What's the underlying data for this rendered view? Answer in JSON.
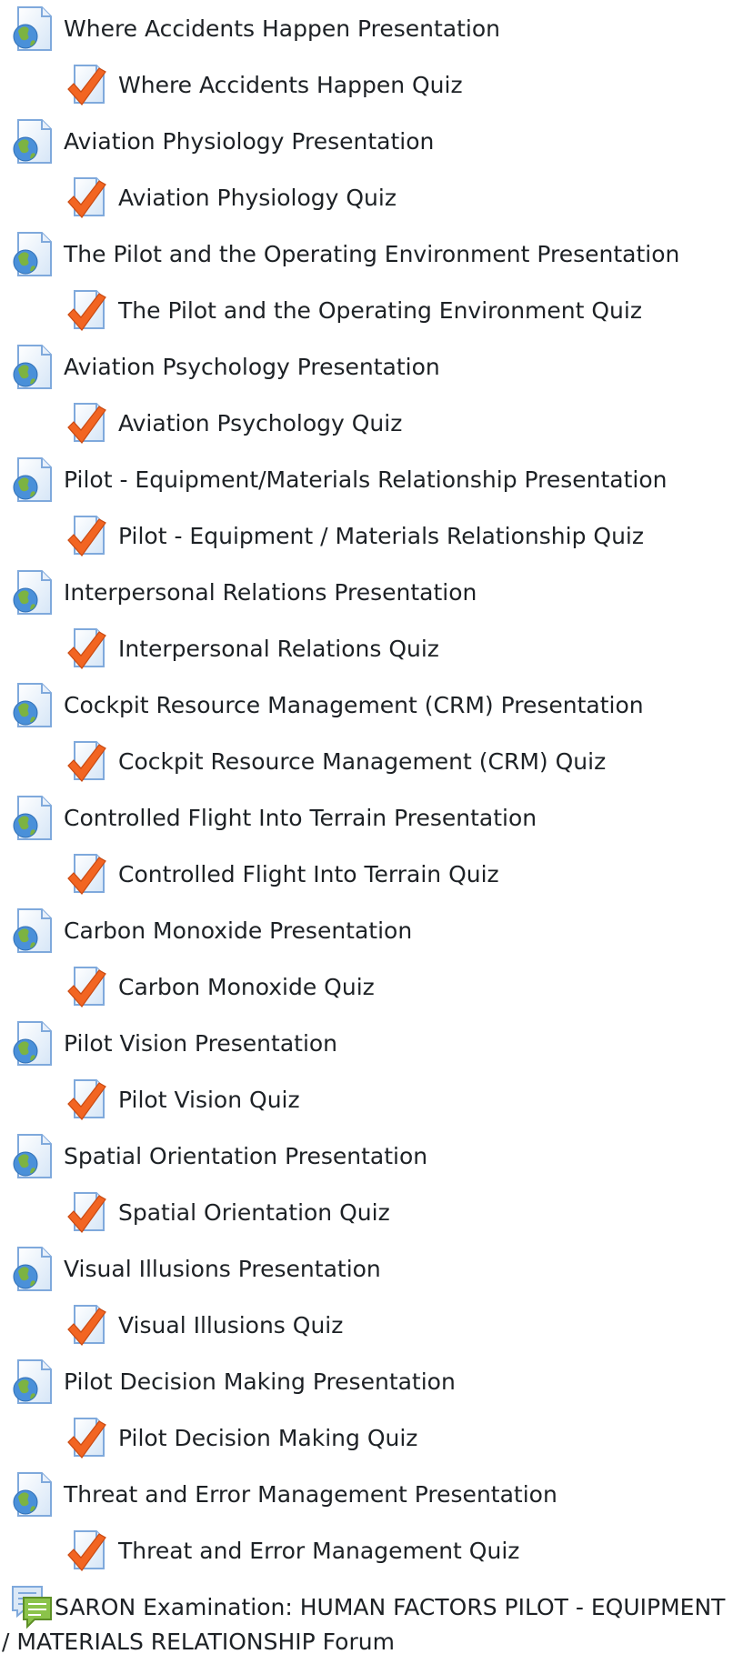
{
  "colors": {
    "page_icon_blue": "#8eb8e6",
    "globe_green": "#7cb342",
    "checkmark_orange": "#f26522",
    "forum_green": "#8bc34a",
    "text": "#1d2125"
  },
  "icons": {
    "presentation": "url-globe-icon",
    "quiz": "quiz-checkmark-icon",
    "forum": "forum-chat-icon"
  },
  "activities": [
    {
      "presentation": "Where Accidents Happen Presentation",
      "quiz": "Where Accidents Happen Quiz"
    },
    {
      "presentation": "Aviation Physiology Presentation",
      "quiz": "Aviation Physiology Quiz"
    },
    {
      "presentation": "The Pilot and the Operating Environment Presentation",
      "quiz": "The Pilot and the Operating Environment Quiz"
    },
    {
      "presentation": "Aviation Psychology Presentation",
      "quiz": "Aviation Psychology Quiz"
    },
    {
      "presentation": "Pilot - Equipment/Materials Relationship Presentation",
      "quiz": "Pilot - Equipment / Materials Relationship Quiz"
    },
    {
      "presentation": "Interpersonal Relations Presentation",
      "quiz": "Interpersonal Relations Quiz"
    },
    {
      "presentation": "Cockpit Resource Management (CRM) Presentation",
      "quiz": "Cockpit Resource Management (CRM) Quiz"
    },
    {
      "presentation": "Controlled Flight Into Terrain Presentation",
      "quiz": "Controlled Flight Into Terrain Quiz"
    },
    {
      "presentation": "Carbon Monoxide Presentation",
      "quiz": "Carbon Monoxide Quiz"
    },
    {
      "presentation": "Pilot Vision Presentation",
      "quiz": "Pilot Vision Quiz"
    },
    {
      "presentation": "Spatial Orientation Presentation",
      "quiz": "Spatial Orientation Quiz"
    },
    {
      "presentation": "Visual Illusions Presentation",
      "quiz": "Visual Illusions Quiz"
    },
    {
      "presentation": "Pilot Decision Making Presentation",
      "quiz": "Pilot Decision Making Quiz"
    },
    {
      "presentation": "Threat and Error Management Presentation",
      "quiz": "Threat and Error Management Quiz"
    }
  ],
  "forum": {
    "label": "SARON Examination: HUMAN FACTORS PILOT - EQUIPMENT / MATERIALS RELATIONSHIP Forum"
  }
}
